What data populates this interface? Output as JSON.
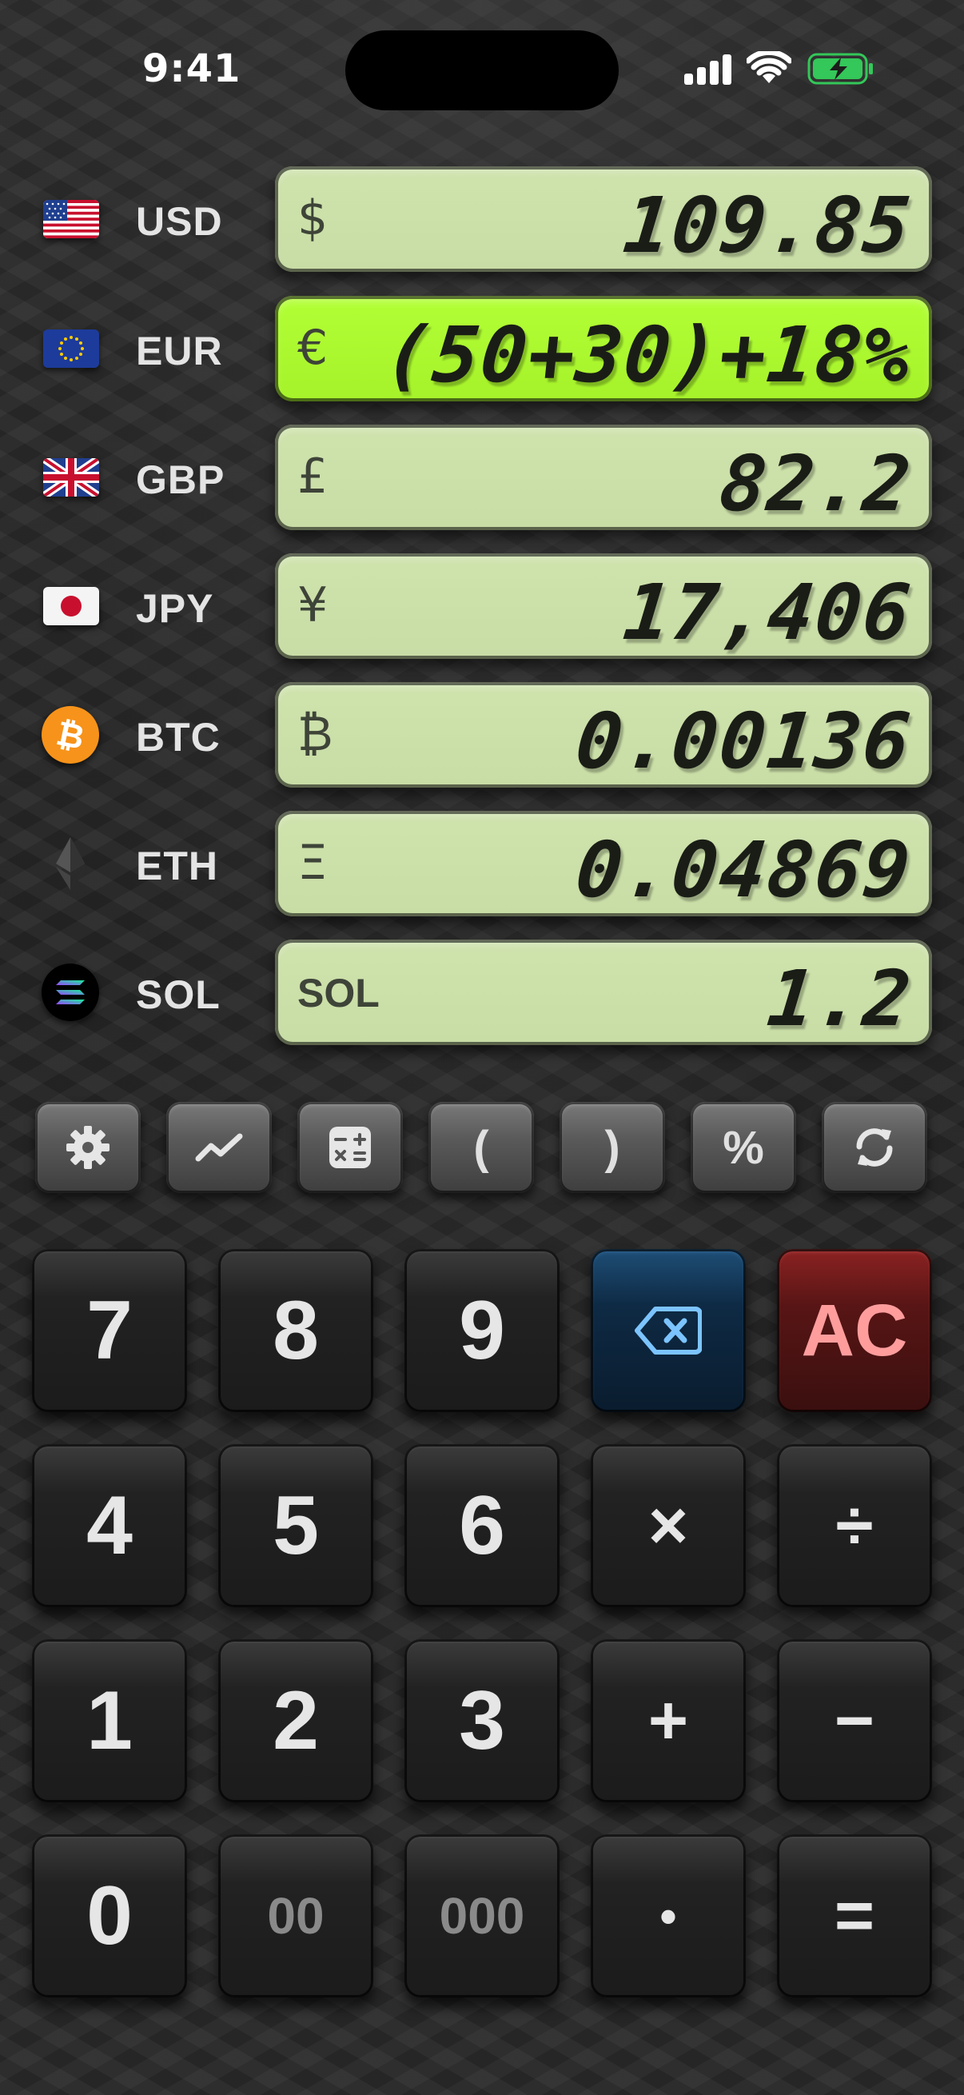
{
  "status_bar": {
    "time": "9:41",
    "icons": [
      "signal-icon",
      "wifi-icon",
      "battery-charging-icon"
    ],
    "battery_color": "#34c759"
  },
  "currencies": [
    {
      "code": "USD",
      "symbol": "$",
      "value": "109.85",
      "icon": "us-flag-icon",
      "active": false
    },
    {
      "code": "EUR",
      "symbol": "€",
      "value": "(50+30)+18%",
      "icon": "eu-flag-icon",
      "active": true
    },
    {
      "code": "GBP",
      "symbol": "£",
      "value": "82.2",
      "icon": "uk-flag-icon",
      "active": false
    },
    {
      "code": "JPY",
      "symbol": "¥",
      "value": "17,406",
      "icon": "japan-flag-icon",
      "active": false
    },
    {
      "code": "BTC",
      "symbol": "₿",
      "value": "0.00136",
      "icon": "bitcoin-icon",
      "active": false
    },
    {
      "code": "ETH",
      "symbol": "Ξ",
      "value": "0.04869",
      "icon": "ethereum-icon",
      "active": false
    },
    {
      "code": "SOL",
      "symbol": "SOL",
      "value": "1.2",
      "icon": "solana-icon",
      "active": false
    }
  ],
  "tools": [
    {
      "name": "settings-icon",
      "label": ""
    },
    {
      "name": "chart-icon",
      "label": ""
    },
    {
      "name": "calculator-icon",
      "label": ""
    },
    {
      "name": "open-paren",
      "label": "("
    },
    {
      "name": "close-paren",
      "label": ")"
    },
    {
      "name": "percent",
      "label": "%"
    },
    {
      "name": "refresh-icon",
      "label": ""
    }
  ],
  "keypad": {
    "k7": "7",
    "k8": "8",
    "k9": "9",
    "backspace_icon": "backspace-icon",
    "clear": "AC",
    "k4": "4",
    "k5": "5",
    "k6": "6",
    "multiply": "×",
    "divide": "÷",
    "k1": "1",
    "k2": "2",
    "k3": "3",
    "plus": "+",
    "minus": "−",
    "k0": "0",
    "k00": "00",
    "k000": "000",
    "decimal": "•",
    "equals": "="
  },
  "colors": {
    "lcd": "#cfe3ad",
    "lcd_active": "#b2ff36",
    "backspace": "#0e2a44",
    "clear": "#581515",
    "clear_text": "#ff9d9d"
  }
}
